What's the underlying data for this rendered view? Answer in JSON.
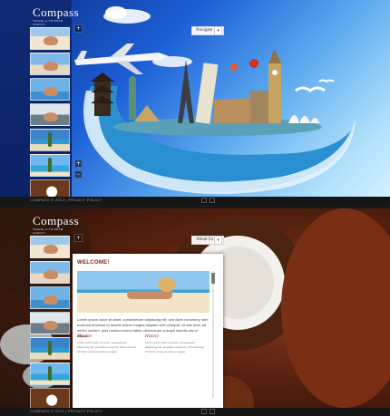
{
  "site": {
    "name": "Compass",
    "tagline": "TRAVEL & TOURISM AGENCY"
  },
  "top_page": {
    "nav_select": {
      "selected": "Navigate",
      "arrow": "▾"
    },
    "side_controls": [
      "+",
      "–"
    ],
    "footer": {
      "text": "COMPASS © 2012 | PRIVACY POLICY"
    }
  },
  "bottom_page": {
    "nav_select": {
      "selected": "About Us",
      "arrow": "▾"
    },
    "side_controls": [
      "+",
      "–"
    ],
    "panel": {
      "title": "WELCOME!",
      "intro": "Lorem ipsum dolor sit amet, consectetuer adipiscing elit, sed diam nonummy nibh euismod tincidunt ut laoreet dolore magna aliquam erat volutpat. Ut wisi enim ad minim veniam, quis nostrud exerci tation ullamcorper suscipit lobortis nisl ut aliquip.",
      "columns": [
        {
          "title": "Mission",
          "text": "Lorem ipsum dolor sit amet, consectetuer adipiscing elit, sed diam nonummy nibh euismod tincidunt ut laoreet dolore magna."
        },
        {
          "title": "History",
          "text": "Lorem ipsum dolor sit amet, consectetuer adipiscing elit, sed diam nonummy nibh euismod tincidunt ut laoreet dolore magna."
        }
      ]
    },
    "footer": {
      "text": "COMPASS © 2012 | PRIVACY POLICY"
    }
  },
  "thumbnails": [
    {
      "name": "beach-woman"
    },
    {
      "name": "couple-beach"
    },
    {
      "name": "woman-pool"
    },
    {
      "name": "spa-stones"
    },
    {
      "name": "palm-beach"
    },
    {
      "name": "tropical-island"
    },
    {
      "name": "coconut"
    }
  ],
  "colors": {
    "accent": "#8a1e10",
    "sky_top": "#0b2f8a",
    "sky_bottom": "#d8f2ff",
    "coconut_bg": "#5a220f"
  }
}
